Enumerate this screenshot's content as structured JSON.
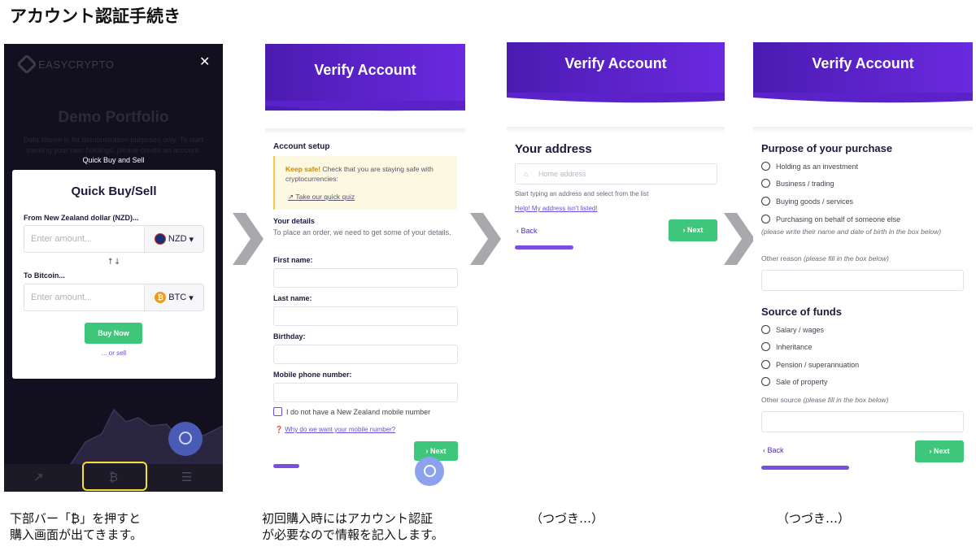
{
  "page_title": "アカウント認証手続き",
  "captions": {
    "p1_line1": "下部バー「₿」を押すと",
    "p1_line2": "購入画面が出てきます。",
    "p2_line1": "初回購入時にはアカウント認証",
    "p2_line2": "が必要なので情報を記入します。",
    "p3": "（つづき…）",
    "p4": "（つづき…）"
  },
  "panel1": {
    "logo_text": "EASYCRYPTO",
    "close_symbol": "✕",
    "background_title": "Demo Portfolio",
    "background_text": "Data shown is for demonstration purposes only. To start tracking your own holdings, please create an account.",
    "overlay_label": "Quick Buy and Sell",
    "modal": {
      "title": "Quick Buy/Sell",
      "from_label": "From New Zealand dollar (NZD)...",
      "from_placeholder": "Enter amount...",
      "from_currency": "NZD",
      "swap_symbol": "↑↓",
      "to_label": "To Bitcoin...",
      "to_placeholder": "Enter amount...",
      "to_currency": "BTC",
      "buy_button": "Buy Now",
      "or_sell": "... or sell"
    },
    "nav": {
      "chart_icon": "↗",
      "bitcoin_icon": "₿",
      "list_icon": "☰"
    },
    "highlight_color": "#f5e22a"
  },
  "verify": {
    "banner_title": "Verify Account",
    "brand_color": "#5a22c8",
    "next_label": "Next",
    "back_label": "Back"
  },
  "panel2": {
    "heading": "Account setup",
    "notice_bold": "Keep safe!",
    "notice_text": " Check that you are staying safe with cryptocurrencies:",
    "notice_link": "Take our quick quiz",
    "details_heading": "Your details",
    "details_text": "To place an order, we need to get some of your details.",
    "first_name_label": "First name:",
    "last_name_label": "Last name:",
    "birthday_label": "Birthday:",
    "mobile_label": "Mobile phone number:",
    "no_mobile_label": "I do not have a New Zealand mobile number",
    "why_link": "Why do we want your mobile number?"
  },
  "panel3": {
    "heading": "Your address",
    "address_placeholder": "Home address",
    "hint": "Start typing an address and select from the list",
    "help_link": "Help! My address isn't listed!"
  },
  "panel4": {
    "purpose_heading": "Purpose of your purchase",
    "purpose_options": [
      "Holding as an investment",
      "Business / trading",
      "Buying goods / services",
      "Purchasing on behalf of someone else"
    ],
    "purpose_note": "(please write their name and date of birth in the box below)",
    "other_reason_label": "Other reason",
    "other_reason_hint": "(please fill in the box below)",
    "funds_heading": "Source of funds",
    "funds_options": [
      "Salary / wages",
      "Inheritance",
      "Pension / superannuation",
      "Sale of property"
    ],
    "other_source_label": "Other source",
    "other_source_hint": "(please fill in the box below)"
  }
}
